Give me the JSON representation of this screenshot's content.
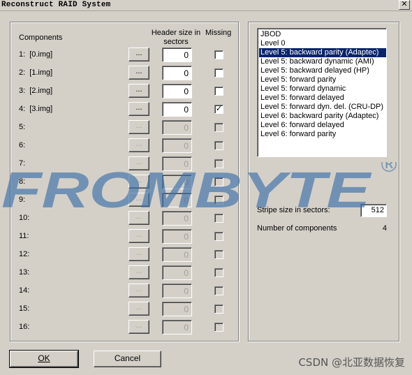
{
  "window": {
    "title": "Reconstruct RAID System",
    "close_glyph": "✕"
  },
  "headers": {
    "components": "Components",
    "header_size": "Header size in sectors",
    "missing": "Missing"
  },
  "rows": [
    {
      "index": "1:",
      "name": "[0.img]",
      "browse": "...",
      "header": "0",
      "missing": false,
      "enabled": true
    },
    {
      "index": "2:",
      "name": "[1.img]",
      "browse": "...",
      "header": "0",
      "missing": false,
      "enabled": true
    },
    {
      "index": "3:",
      "name": "[2.img]",
      "browse": "...",
      "header": "0",
      "missing": false,
      "enabled": true
    },
    {
      "index": "4:",
      "name": "[3.img]",
      "browse": "...",
      "header": "0",
      "missing": true,
      "enabled": true
    },
    {
      "index": "5:",
      "name": "",
      "browse": "...",
      "header": "0",
      "missing": false,
      "enabled": false
    },
    {
      "index": "6:",
      "name": "",
      "browse": "...",
      "header": "0",
      "missing": false,
      "enabled": false
    },
    {
      "index": "7:",
      "name": "",
      "browse": "...",
      "header": "0",
      "missing": false,
      "enabled": false
    },
    {
      "index": "8:",
      "name": "",
      "browse": "...",
      "header": "0",
      "missing": false,
      "enabled": false
    },
    {
      "index": "9:",
      "name": "",
      "browse": "...",
      "header": "0",
      "missing": false,
      "enabled": false
    },
    {
      "index": "10:",
      "name": "",
      "browse": "...",
      "header": "0",
      "missing": false,
      "enabled": false
    },
    {
      "index": "11:",
      "name": "",
      "browse": "...",
      "header": "0",
      "missing": false,
      "enabled": false
    },
    {
      "index": "12:",
      "name": "",
      "browse": "...",
      "header": "0",
      "missing": false,
      "enabled": false
    },
    {
      "index": "13:",
      "name": "",
      "browse": "...",
      "header": "0",
      "missing": false,
      "enabled": false
    },
    {
      "index": "14:",
      "name": "",
      "browse": "...",
      "header": "0",
      "missing": false,
      "enabled": false
    },
    {
      "index": "15:",
      "name": "",
      "browse": "...",
      "header": "0",
      "missing": false,
      "enabled": false
    },
    {
      "index": "16:",
      "name": "",
      "browse": "...",
      "header": "0",
      "missing": false,
      "enabled": false
    }
  ],
  "raid_levels": {
    "selected": "Level 5: backward parity (Adaptec)",
    "items": [
      "JBOD",
      "Level 0",
      "Level 5: backward parity (Adaptec)",
      "Level 5: backward dynamic (AMI)",
      "Level 5: backward delayed (HP)",
      "Level 5: forward parity",
      "Level 5: forward dynamic",
      "Level 5: forward delayed",
      "Level 5: forward dyn. del. (CRU-DP)",
      "Level 6: backward parity (Adaptec)",
      "Level 6: forward delayed",
      "Level 6: forward parity"
    ]
  },
  "stripe": {
    "label": "Stripe size in sectors:",
    "value": "512"
  },
  "num_components": {
    "label": "Number of components",
    "value": "4"
  },
  "buttons": {
    "ok": "OK",
    "cancel": "Cancel"
  },
  "watermark": {
    "text": "FROMBYTE",
    "registered": "®",
    "blue": "#3a6fa8",
    "green": "#5cb85c"
  },
  "corner_watermark": "CSDN @北亚数据恢复"
}
